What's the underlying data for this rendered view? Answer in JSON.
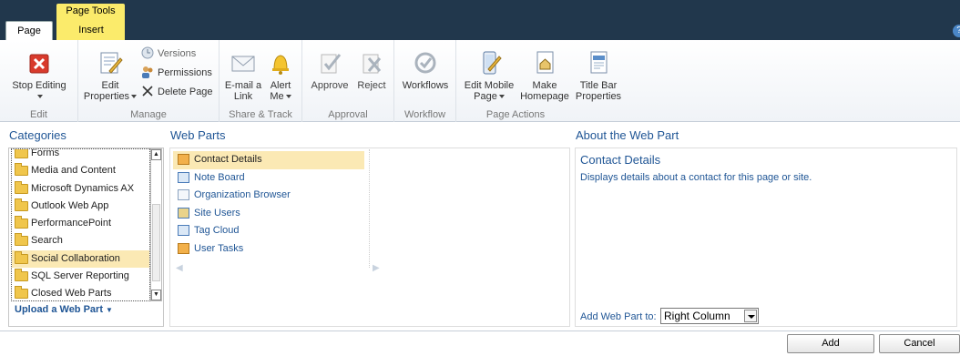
{
  "tabs": {
    "context_group": "Page Tools",
    "page": "Page",
    "insert": "Insert"
  },
  "ribbon": {
    "edit_group": {
      "label": "Edit",
      "stop_editing": "Stop Editing"
    },
    "manage_group": {
      "label": "Manage",
      "edit_properties_line1": "Edit",
      "edit_properties_line2": "Properties",
      "versions": "Versions",
      "permissions": "Permissions",
      "delete_page": "Delete Page"
    },
    "share_group": {
      "label": "Share & Track",
      "email_line1": "E-mail a",
      "email_line2": "Link",
      "alert_line1": "Alert",
      "alert_line2": "Me"
    },
    "approval_group": {
      "label": "Approval",
      "approve": "Approve",
      "reject": "Reject"
    },
    "workflow_group": {
      "label": "Workflow",
      "workflows": "Workflows"
    },
    "page_actions_group": {
      "label": "Page Actions",
      "edit_mobile_line1": "Edit Mobile",
      "edit_mobile_line2": "Page",
      "make_home_line1": "Make",
      "make_home_line2": "Homepage",
      "title_bar_line1": "Title Bar",
      "title_bar_line2": "Properties"
    }
  },
  "categories": {
    "heading": "Categories",
    "items": [
      {
        "label": "Forms"
      },
      {
        "label": "Media and Content"
      },
      {
        "label": "Microsoft Dynamics AX"
      },
      {
        "label": "Outlook Web App"
      },
      {
        "label": "PerformancePoint"
      },
      {
        "label": "Search"
      },
      {
        "label": "Social Collaboration"
      },
      {
        "label": "SQL Server Reporting"
      },
      {
        "label": "Closed Web Parts"
      }
    ],
    "upload_link": "Upload a Web Part"
  },
  "web_parts": {
    "heading": "Web Parts",
    "items": [
      {
        "label": "Contact Details"
      },
      {
        "label": "Note Board"
      },
      {
        "label": "Organization Browser"
      },
      {
        "label": "Site Users"
      },
      {
        "label": "Tag Cloud"
      },
      {
        "label": "User Tasks"
      }
    ]
  },
  "about": {
    "heading": "About the Web Part",
    "title": "Contact Details",
    "description": "Displays details about a contact for this page or site.",
    "add_to_label": "Add Web Part to:",
    "add_to_value": "Right Column"
  },
  "buttons": {
    "add": "Add",
    "cancel": "Cancel"
  },
  "colors": {
    "top_bar": "#21374c",
    "context_tab": "#fbeb6b",
    "link_blue": "#1f5595",
    "selection": "#fbe9b4"
  }
}
